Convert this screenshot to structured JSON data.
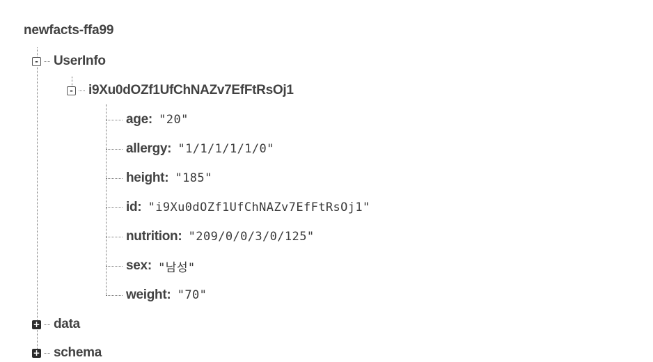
{
  "root": {
    "label": "newfacts-ffa99"
  },
  "tree": {
    "userinfo": {
      "label": "UserInfo",
      "toggle": "-"
    },
    "user": {
      "label": "i9Xu0dOZf1UfChNAZv7EfFtRsOj1",
      "toggle": "-"
    },
    "fields": [
      {
        "key": "age",
        "value": "\"20\""
      },
      {
        "key": "allergy",
        "value": "\"1/1/1/1/1/0\""
      },
      {
        "key": "height",
        "value": "\"185\""
      },
      {
        "key": "id",
        "value": "\"i9Xu0dOZf1UfChNAZv7EfFtRsOj1\""
      },
      {
        "key": "nutrition",
        "value": "\"209/0/0/3/0/125\""
      },
      {
        "key": "sex",
        "value": "\"남성\""
      },
      {
        "key": "weight",
        "value": "\"70\""
      }
    ],
    "data": {
      "label": "data",
      "toggle": "+"
    },
    "schema": {
      "label": "schema",
      "toggle": "+"
    }
  },
  "colon": ":"
}
